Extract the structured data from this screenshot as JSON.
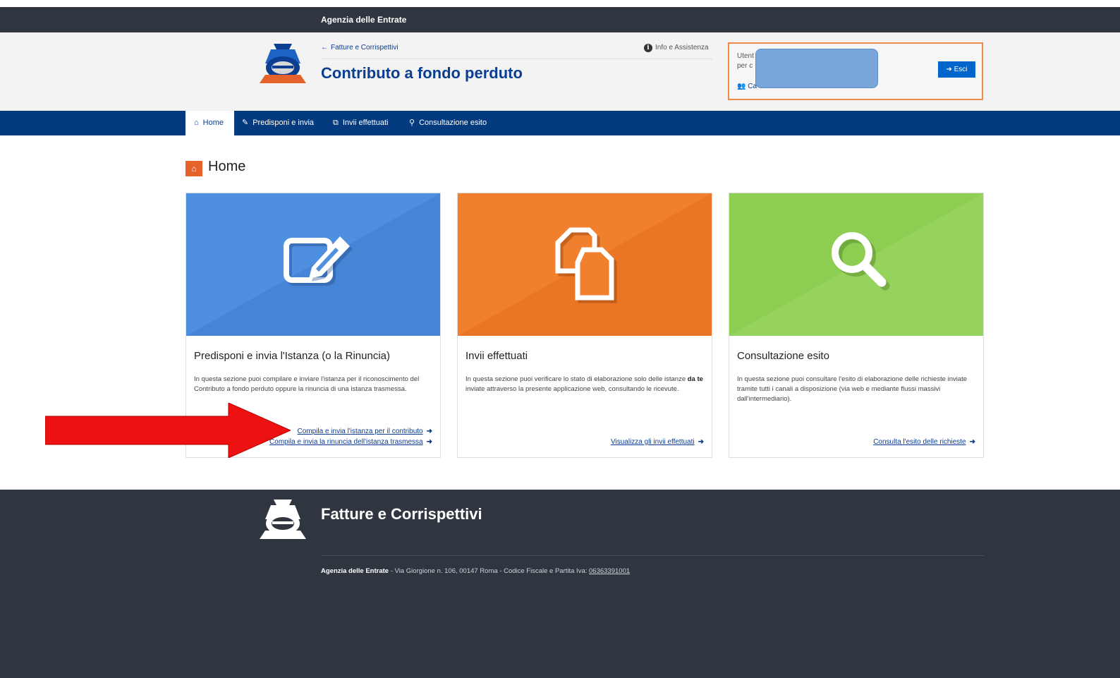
{
  "topbar": {
    "agency": "Agenzia delle Entrate"
  },
  "header": {
    "back_link": "Fatture e Corrispettivi",
    "app_title": "Contributo a fondo perduto",
    "info": "Info e Assistenza",
    "user": {
      "line1": "Utent",
      "line2": "per c",
      "line3": "Ca",
      "logout": "Esci"
    }
  },
  "nav": [
    {
      "label": "Home",
      "icon": "home-icon"
    },
    {
      "label": "Predisponi e invia",
      "icon": "edit-icon"
    },
    {
      "label": "Invii effettuati",
      "icon": "copy-icon"
    },
    {
      "label": "Consultazione esito",
      "icon": "search-icon"
    }
  ],
  "page": {
    "title": "Home"
  },
  "cards": [
    {
      "title": "Predisponi e invia l'Istanza (o la Rinuncia)",
      "text": "In questa sezione puoi compilare e inviare l'istanza per il riconoscimento del Contributo a fondo perduto oppure la rinuncia di una istanza trasmessa.",
      "links": [
        "Compila e invia l'istanza per il contributo",
        "Compila e invia la rinuncia dell'istanza trasmessa"
      ],
      "color": "#4f8fe0",
      "icon": "edit-icon"
    },
    {
      "title": "Invii effettuati",
      "text_before": "In questa sezione puoi verificare lo stato di elaborazione solo delle istanze ",
      "text_bold": "da te",
      "text_after": " inviate attraverso la presente applicazione web, consultando le ricevute.",
      "links": [
        "Visualizza gli invii effettuati"
      ],
      "color": "#f07f2e",
      "icon": "copy-icon"
    },
    {
      "title": "Consultazione esito",
      "text": "In questa sezione puoi consultare l'esito di elaborazione delle richieste inviate tramite tutti i canali a disposizione (via web e mediante flussi massivi dall'intermediario).",
      "links": [
        "Consulta l'esito delle richieste"
      ],
      "color": "#8dcd52",
      "icon": "search-icon"
    }
  ],
  "footer": {
    "title": "Fatture e Corrispettivi",
    "agency": "Agenzia delle Entrate",
    "address": " - Via Giorgione n. 106, 00147 Roma - Codice Fiscale e Partita Iva: ",
    "piva": "06363391001"
  }
}
